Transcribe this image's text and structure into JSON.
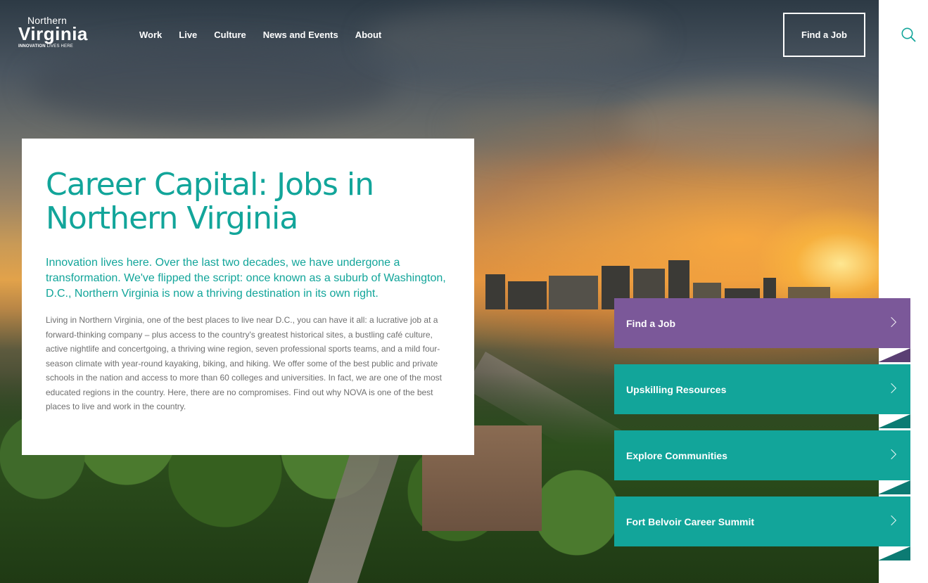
{
  "brand": {
    "logo_top": "Northern",
    "logo_main": "Virginia",
    "logo_tag_bold": "INNOVATION",
    "logo_tag_rest": " LIVES HERE"
  },
  "nav": {
    "items": [
      "Work",
      "Live",
      "Culture",
      "News and Events",
      "About"
    ]
  },
  "header": {
    "cta_label": "Find a Job",
    "search_icon": "search-icon"
  },
  "hero": {
    "title": "Career Capital: Jobs in Northern Virginia",
    "lead": "Innovation lives here. Over the last two decades, we have undergone a transformation. We've flipped the script: once known as a suburb of Washington, D.C., Northern Virginia is now a thriving destination in its own right.",
    "body": "Living in Northern Virginia, one of the best places to live near D.C., you can have it all: a lucrative job at a forward-thinking company – plus access to the country's greatest historical sites, a bustling café culture, active nightlife and concertgoing, a thriving wine region, seven professional sports teams, and a mild four-season climate with year-round kayaking, biking, and hiking. We offer some of the best public and private schools in the nation and access to more than 60 colleges and universities. In fact, we are one of the most educated regions in the country. Here, there are no compromises. Find out why NOVA is one of the best places to live and work in the country."
  },
  "tiles": [
    {
      "label": "Find a Job",
      "color": "#7b5899",
      "flag": "#5a3f73"
    },
    {
      "label": "Upskilling Resources",
      "color": "#12a59a",
      "flag": "#0c7b73"
    },
    {
      "label": "Explore Communities",
      "color": "#12a59a",
      "flag": "#0c7b73"
    },
    {
      "label": "Fort Belvoir Career Summit",
      "color": "#12a59a",
      "flag": "#0c7b73"
    }
  ],
  "colors": {
    "teal": "#12a59a",
    "purple": "#7b5899",
    "body_text": "#6f6f6f"
  }
}
